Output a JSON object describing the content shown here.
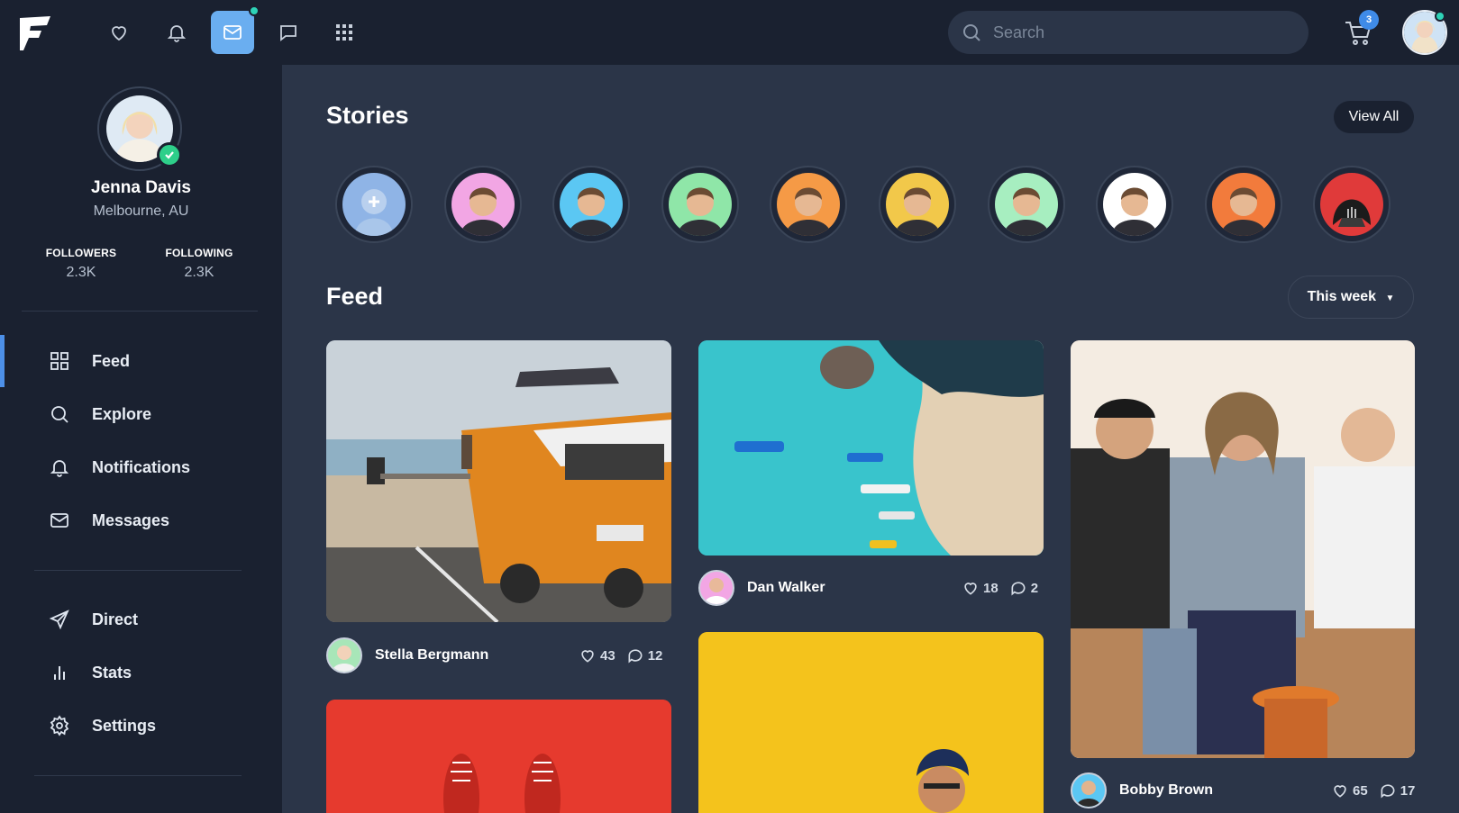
{
  "header": {
    "logo_letter": "F",
    "nav_icons": [
      "heart-icon",
      "bell-icon",
      "mail-icon",
      "chat-icon",
      "grid-icon"
    ],
    "active_nav": "mail-icon",
    "search_placeholder": "Search",
    "cart_count": "3"
  },
  "profile": {
    "name": "Jenna Davis",
    "location": "Melbourne, AU",
    "followers_label": "FOLLOWERS",
    "followers_value": "2.3K",
    "following_label": "FOLLOWING",
    "following_value": "2.3K"
  },
  "sidebar": {
    "items": [
      {
        "label": "Feed",
        "icon": "grid-icon"
      },
      {
        "label": "Explore",
        "icon": "search-icon"
      },
      {
        "label": "Notifications",
        "icon": "bell-icon"
      },
      {
        "label": "Messages",
        "icon": "mail-icon"
      },
      {
        "label": "Direct",
        "icon": "send-icon"
      },
      {
        "label": "Stats",
        "icon": "bar-chart-icon"
      },
      {
        "label": "Settings",
        "icon": "gear-icon"
      }
    ]
  },
  "stories": {
    "title": "Stories",
    "view_all": "View All",
    "colors": [
      "#8fb4e6",
      "#f2a6e4",
      "#5bc7f3",
      "#8fe6a8",
      "#f59a46",
      "#f2c84a",
      "#a7eec0",
      "#ffffff",
      "#f27b3c",
      "#e03a3a"
    ]
  },
  "feed": {
    "title": "Feed",
    "filter": "This week",
    "posts": [
      {
        "author": "Stella Bergmann",
        "likes": "43",
        "comments": "12"
      },
      {
        "author": "Dan Walker",
        "likes": "18",
        "comments": "2"
      },
      {
        "author": "Bobby Brown",
        "likes": "65",
        "comments": "17"
      }
    ]
  },
  "colors": {
    "accent": "#4d90e8",
    "online": "#2ed3b7",
    "verified": "#2ecf8a"
  }
}
